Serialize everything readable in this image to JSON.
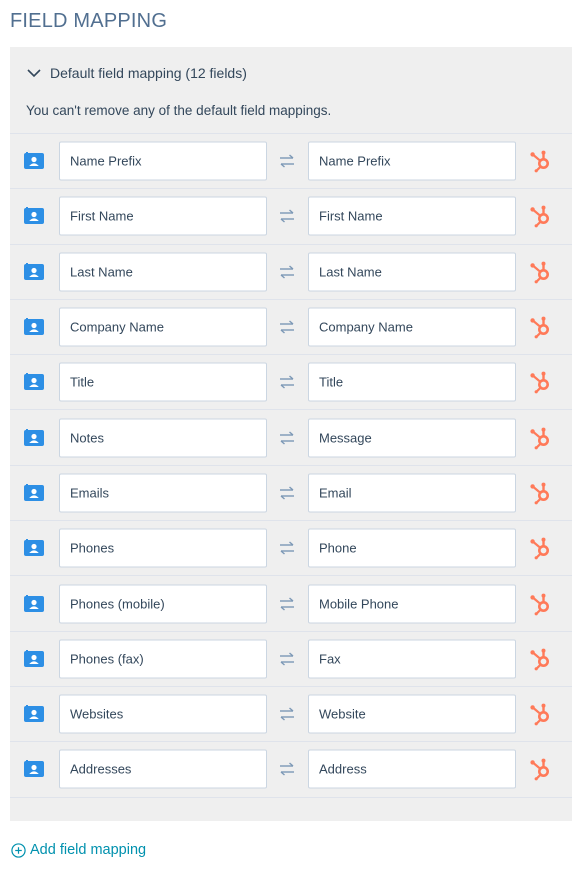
{
  "page": {
    "title": "FIELD MAPPING"
  },
  "accordion": {
    "title": "Default field mapping (12 fields)",
    "note": "You can't remove any of the default field mappings."
  },
  "mappings": [
    {
      "source": "Name Prefix",
      "target": "Name Prefix"
    },
    {
      "source": "First Name",
      "target": "First Name"
    },
    {
      "source": "Last Name",
      "target": "Last Name"
    },
    {
      "source": "Company Name",
      "target": "Company Name"
    },
    {
      "source": "Title",
      "target": "Title"
    },
    {
      "source": "Notes",
      "target": "Message"
    },
    {
      "source": "Emails",
      "target": "Email"
    },
    {
      "source": "Phones",
      "target": "Phone"
    },
    {
      "source": "Phones (mobile)",
      "target": "Mobile Phone"
    },
    {
      "source": "Phones (fax)",
      "target": "Fax"
    },
    {
      "source": "Websites",
      "target": "Website"
    },
    {
      "source": "Addresses",
      "target": "Address"
    }
  ],
  "footer": {
    "add_label": "Add field mapping"
  },
  "icons": {
    "source_app": "contact-card-icon",
    "swap": "swap-arrows-icon",
    "target_app": "hubspot-sprocket-icon",
    "expand": "chevron-down-icon",
    "add": "plus-circle-icon"
  },
  "colors": {
    "source_icon": "#2d8fe5",
    "hubspot": "#ff7a59",
    "link": "#0091ae",
    "panel_bg": "#efefef"
  }
}
